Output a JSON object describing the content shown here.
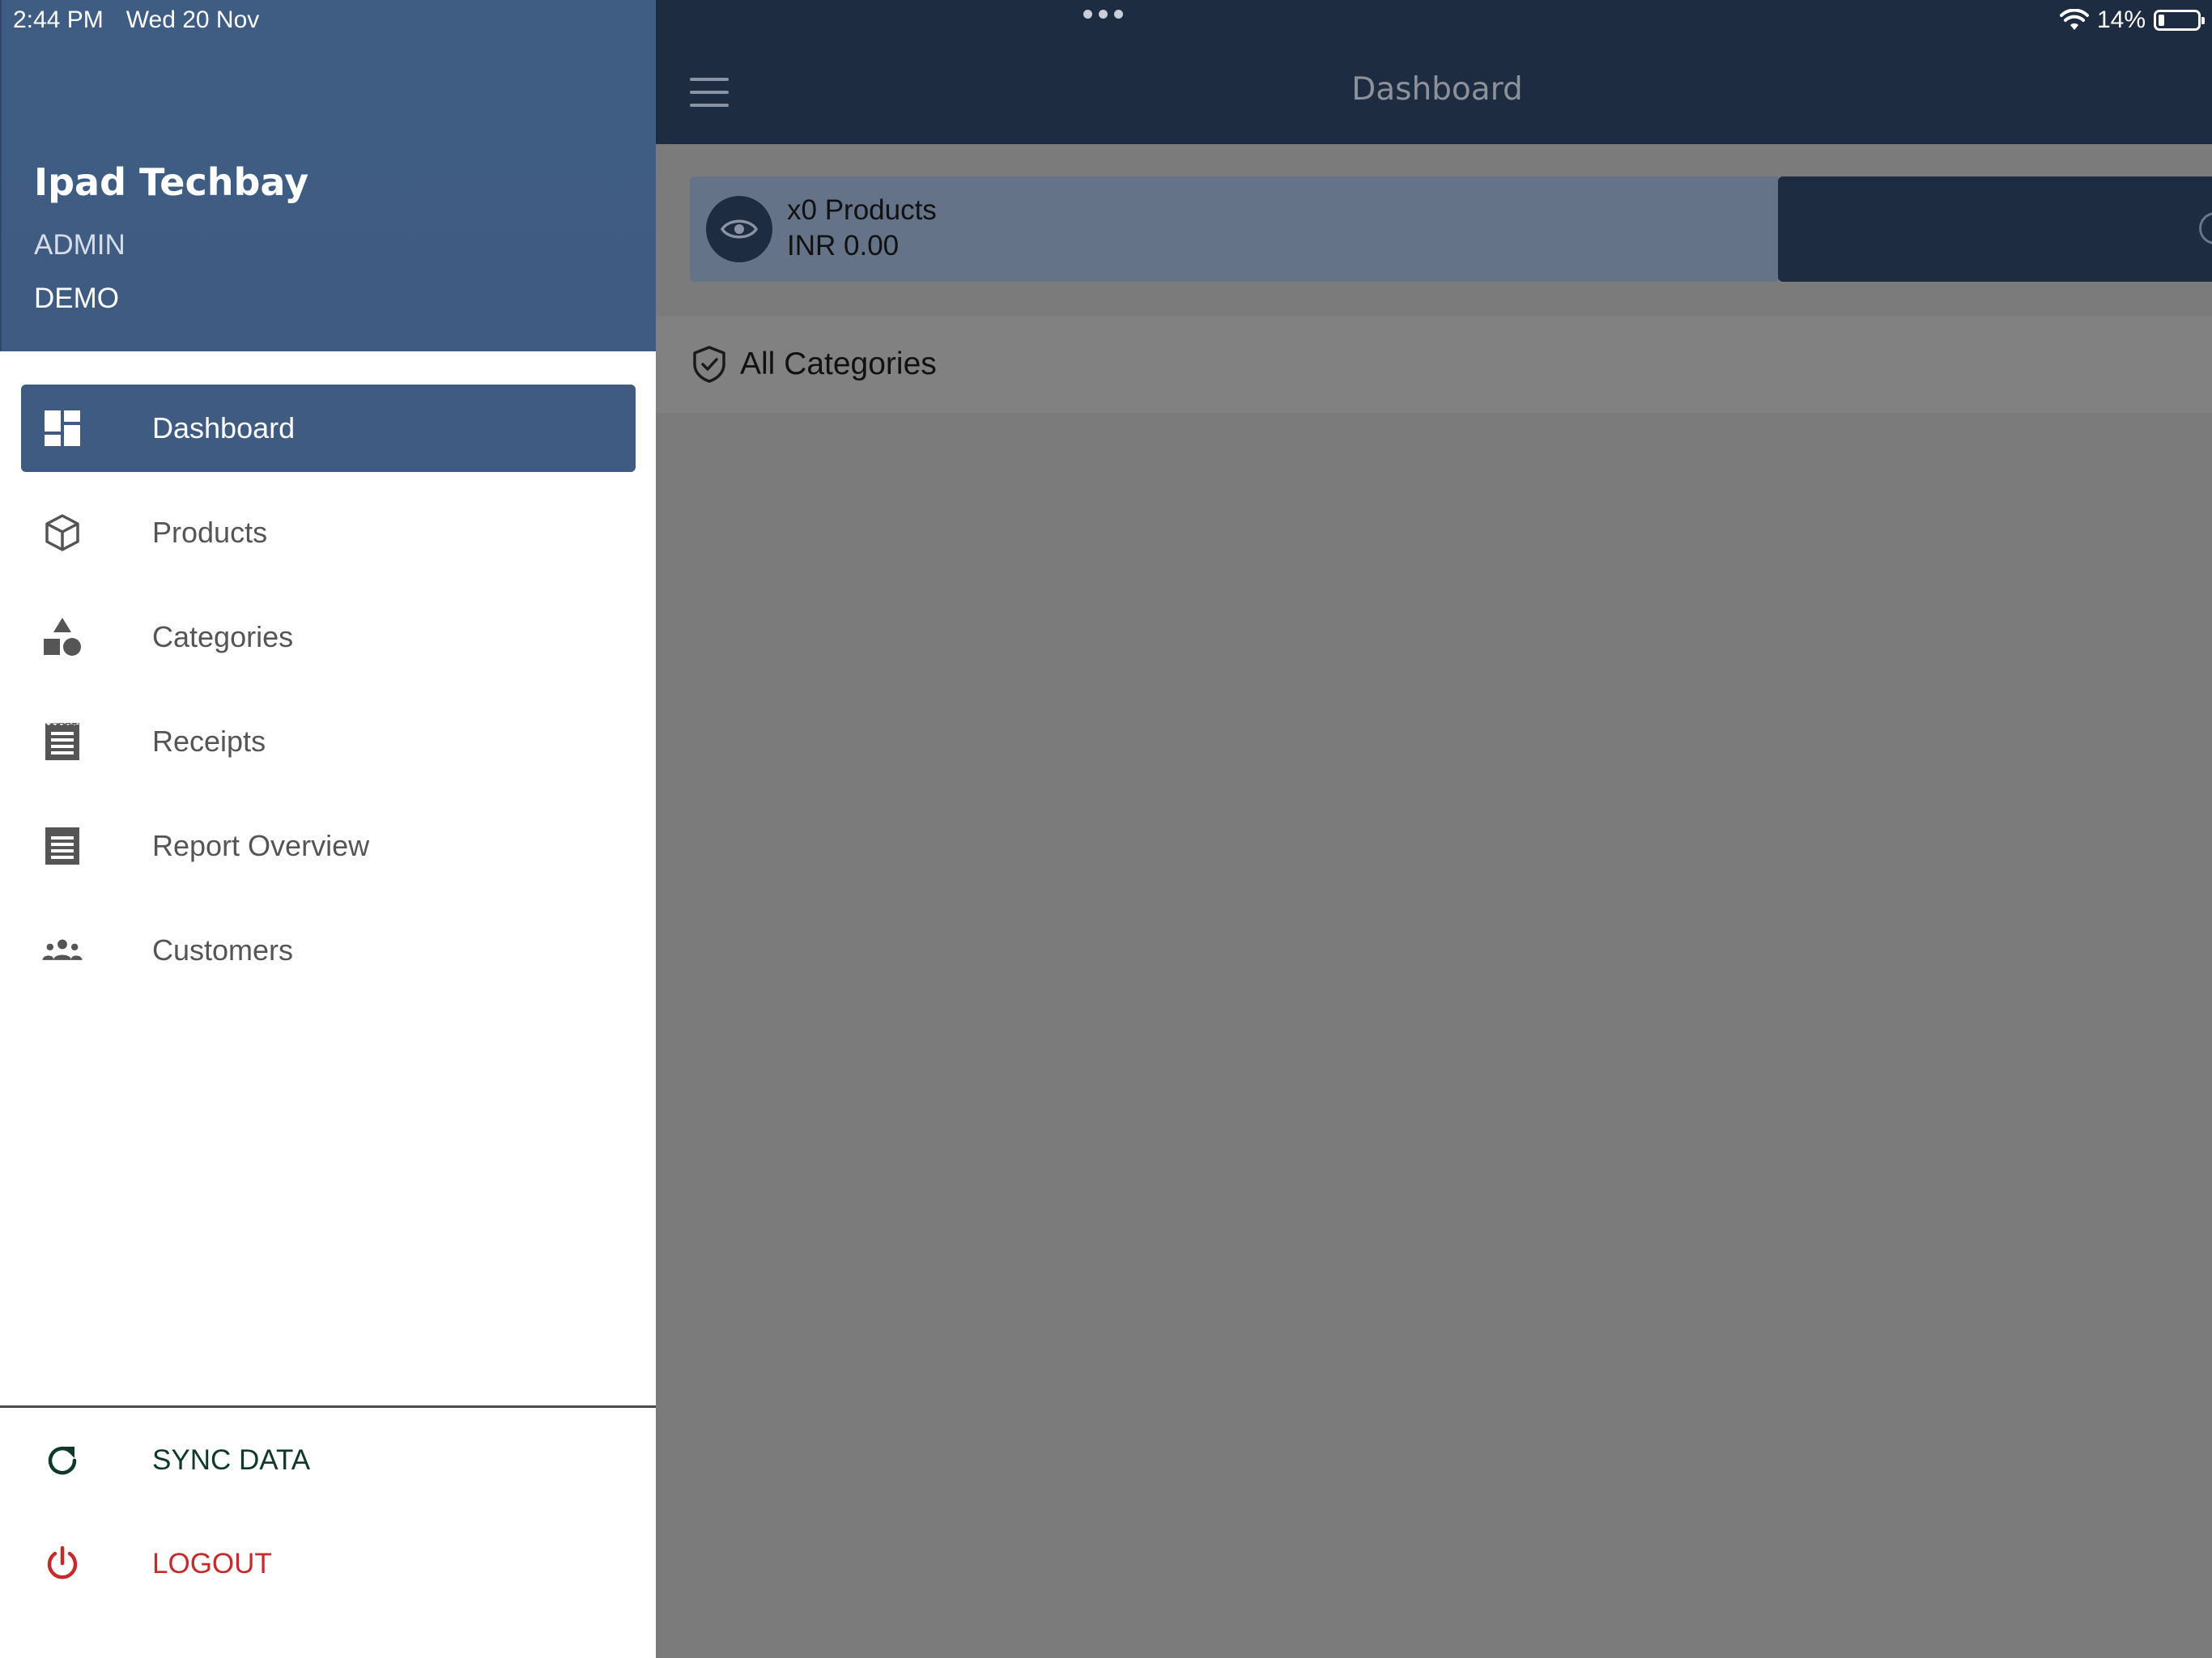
{
  "status_bar": {
    "time": "2:44 PM",
    "date": "Wed 20 Nov",
    "battery": "14%",
    "battery_level": 0.14
  },
  "drawer": {
    "user_name": "Ipad Techbay",
    "user_role": "ADMIN",
    "user_org": "DEMO",
    "items": [
      {
        "label": "Dashboard",
        "icon": "dashboard-icon",
        "active": true
      },
      {
        "label": "Products",
        "icon": "cube-icon",
        "active": false
      },
      {
        "label": "Categories",
        "icon": "shapes-icon",
        "active": false
      },
      {
        "label": "Receipts",
        "icon": "receipt-icon",
        "active": false
      },
      {
        "label": "Report Overview",
        "icon": "report-icon",
        "active": false
      },
      {
        "label": "Customers",
        "icon": "people-icon",
        "active": false
      }
    ],
    "sync_label": "SYNC DATA",
    "logout_label": "LOGOUT"
  },
  "topbar": {
    "title": "Dashboard",
    "menu_icon": "hamburger-icon"
  },
  "summary": {
    "count": "x0 Products",
    "total": "INR 0.00",
    "icon": "eye-icon"
  },
  "categories": {
    "label": "All Categories",
    "icon": "shield-check-icon"
  },
  "colors": {
    "drawer_header": "#3f5b82",
    "topbar": "#1e2c42",
    "overlay": "#7b7b7b",
    "sync": "#0f3a2a",
    "logout": "#c62a2a"
  }
}
